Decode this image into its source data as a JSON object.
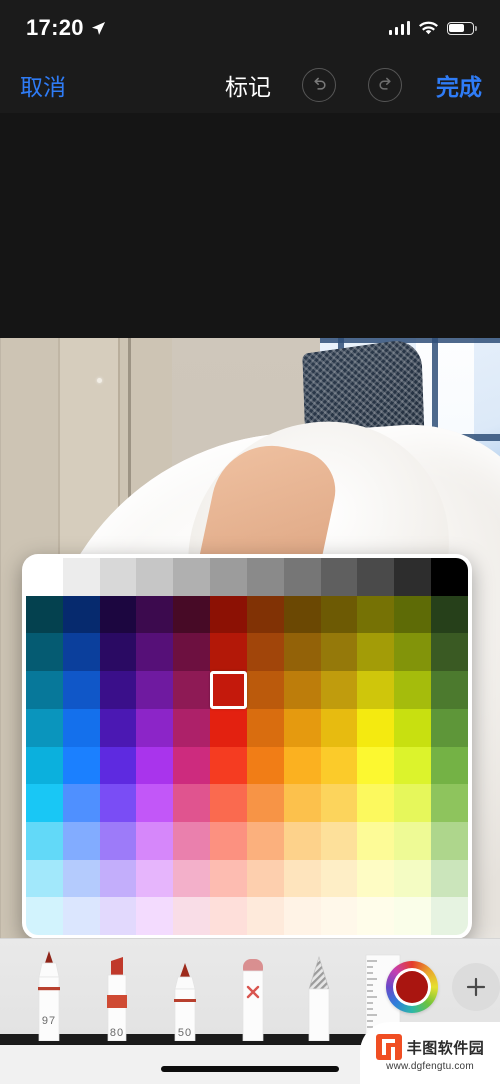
{
  "status_bar": {
    "time": "17:20",
    "location_icon": "location-arrow-icon",
    "signal_icon": "cellular-bars-icon",
    "wifi_icon": "wifi-icon",
    "battery_icon": "battery-icon",
    "battery_level_percent": 68
  },
  "nav_bar": {
    "cancel_label": "取消",
    "title": "标记",
    "undo_icon": "undo-icon",
    "redo_icon": "redo-icon",
    "done_label": "完成",
    "accent_color": "#2f7cf6",
    "background_color": "#1b1b1b"
  },
  "canvas": {
    "background_color": "#151515",
    "photo_description": "白色抓绒连帽衫照片"
  },
  "color_picker": {
    "columns": 12,
    "rows": 10,
    "selected_color": "#c4190c",
    "selected_row": 3,
    "selected_col": 5,
    "panel_background": "#ffffff",
    "rows_data": [
      [
        "#ffffff",
        "#ececec",
        "#d8d8d8",
        "#c6c6c6",
        "#b0b0b0",
        "#9c9c9c",
        "#8a8a8a",
        "#767676",
        "#5f5f5f",
        "#4a4a4a",
        "#2d2d2d",
        "#000000"
      ],
      [
        "#04414f",
        "#062a6e",
        "#1c0640",
        "#3c0a4e",
        "#470a26",
        "#8c1104",
        "#813205",
        "#6b4803",
        "#6d5a04",
        "#767205",
        "#5e6b06",
        "#26401a"
      ],
      [
        "#055b72",
        "#0b3f9c",
        "#2a0a63",
        "#561078",
        "#6d1040",
        "#b31808",
        "#a1450a",
        "#936208",
        "#95790a",
        "#a39c07",
        "#82940a",
        "#3a5a23"
      ],
      [
        "#07789a",
        "#1057c8",
        "#3a0f8a",
        "#6f1aa0",
        "#8e1a55",
        "#c4190c",
        "#bb5a0c",
        "#bd7d0b",
        "#c09c0d",
        "#cfc60b",
        "#a5bc0c",
        "#4c7a2e"
      ],
      [
        "#0a95bd",
        "#1470ec",
        "#4b18b3",
        "#8c25c8",
        "#ad2169",
        "#e32110",
        "#d96d0f",
        "#e59a0f",
        "#e7bb10",
        "#f4ea10",
        "#c8e010",
        "#5e9639"
      ],
      [
        "#0bb0dd",
        "#1b80ff",
        "#5e2ae0",
        "#a934ec",
        "#cd2b7e",
        "#f53c21",
        "#f17d16",
        "#fbb120",
        "#fbcb2a",
        "#fcf830",
        "#dcf32c",
        "#74b245"
      ],
      [
        "#19c7f5",
        "#4f90ff",
        "#7a4df5",
        "#c257f8",
        "#e0548f",
        "#fa6a4f",
        "#f79446",
        "#fcc14c",
        "#fcd45c",
        "#fcf95e",
        "#e6f75b",
        "#8ec45d"
      ],
      [
        "#62d9f8",
        "#82acff",
        "#9d7bf9",
        "#d687fa",
        "#ea80ad",
        "#fc9180",
        "#fbb07d",
        "#fdd28b",
        "#fde09a",
        "#fdfb97",
        "#eefa95",
        "#aed68c"
      ],
      [
        "#a2e8fb",
        "#b4cbfd",
        "#c3aefb",
        "#e6b5fc",
        "#f3b0ca",
        "#fdbcb1",
        "#fdcfae",
        "#fee4bd",
        "#feeec6",
        "#fefcc4",
        "#f4fcc3",
        "#cbe5bb"
      ],
      [
        "#d2f3fd",
        "#dbe6fe",
        "#e2d9fd",
        "#f3dbfe",
        "#f9dde7",
        "#fedfda",
        "#feeadb",
        "#fff3e6",
        "#fff8ea",
        "#fffdea",
        "#fafee9",
        "#e6f3e1"
      ]
    ]
  },
  "toolbar": {
    "tools": [
      {
        "name": "pen-tool",
        "number": "97",
        "selected": true
      },
      {
        "name": "highlighter-tool",
        "number": "80",
        "selected": false
      },
      {
        "name": "marker-tool",
        "number": "50",
        "selected": false
      },
      {
        "name": "eraser-tool",
        "number": "",
        "selected": false
      },
      {
        "name": "pencil-tool",
        "number": "",
        "selected": false
      },
      {
        "name": "ruler-tool",
        "number": "",
        "selected": false
      }
    ],
    "color_wheel_icon": "color-wheel-icon",
    "current_color": "#a91510",
    "add_button_icon": "plus-icon",
    "background_color": "#e6e6e6"
  },
  "watermark": {
    "brand": "丰图软件园",
    "url": "www.dgfengtu.com",
    "logo_color": "#f04e23"
  },
  "home_indicator": {
    "label": "home-indicator"
  }
}
